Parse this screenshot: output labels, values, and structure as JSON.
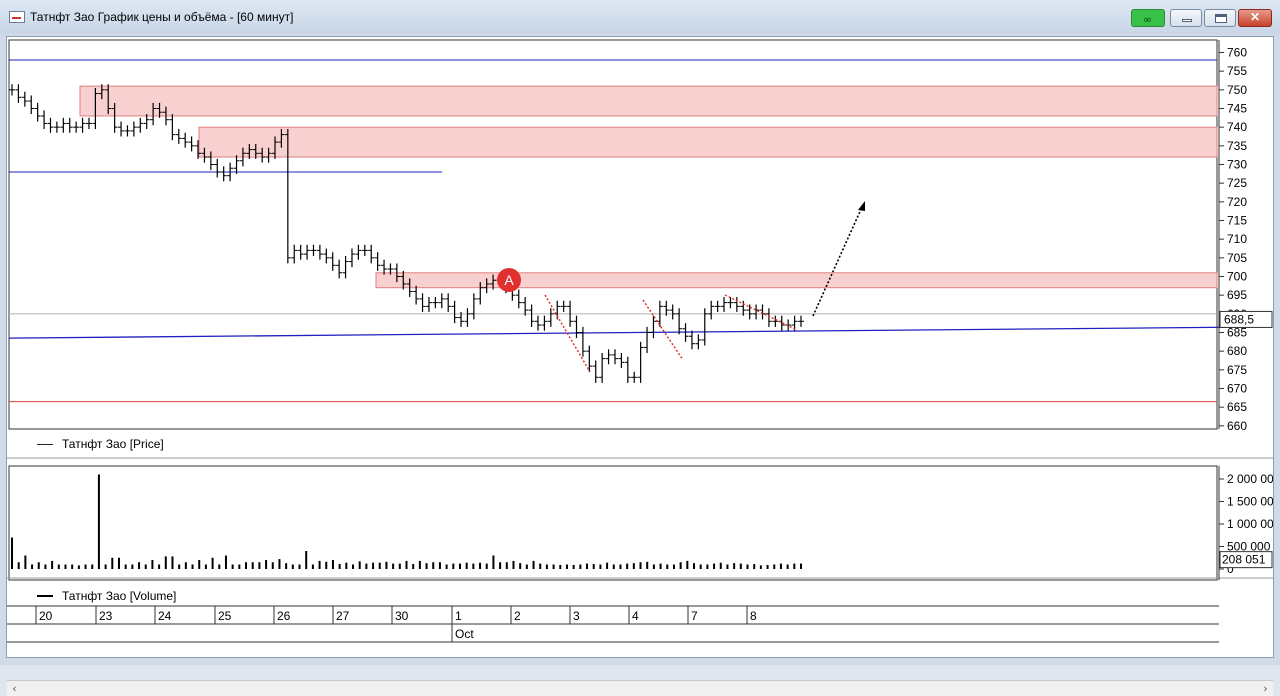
{
  "window": {
    "title": "Татнфт Зао График цены и объёма - [60 минут]",
    "close_label": "✕"
  },
  "price_panel": {
    "legend": "Татнфт Зао [Price]",
    "last_value_label": "688,5"
  },
  "volume_panel": {
    "legend": "Татнфт Зао [Volume]",
    "last_value_label": "208 051"
  },
  "annotation_marker": "A",
  "colors": {
    "zone_fill": "#f8d0d0",
    "zone_stroke": "#e08080",
    "support_line": "#2020c0",
    "bottom_line": "#e04040",
    "bars": "#000000",
    "projection_arrow": "#000000",
    "marker_bg": "#e03030",
    "dotted_trend": "#e03030"
  },
  "chart_data": [
    {
      "type": "ohlc",
      "title": "",
      "y_axis": {
        "min": 658,
        "max": 763,
        "ticks": [
          760,
          755,
          750,
          745,
          740,
          735,
          730,
          725,
          720,
          715,
          710,
          705,
          700,
          695,
          690,
          685,
          680,
          675,
          670,
          665,
          660
        ]
      },
      "x_axis": {
        "ticks": [
          "20",
          "23",
          "24",
          "25",
          "26",
          "27",
          "30",
          "1",
          "2",
          "3",
          "4",
          "7",
          "8"
        ],
        "month_label": "Oct"
      },
      "price_series": [
        750,
        748,
        747,
        745,
        743,
        741,
        740,
        740,
        741,
        740,
        740,
        741,
        741,
        749,
        750,
        745,
        740,
        739,
        739,
        740,
        741,
        742,
        745,
        744,
        742,
        738,
        737,
        736,
        735,
        733,
        732,
        730,
        728,
        727,
        729,
        731,
        733,
        734,
        733,
        732,
        733,
        736,
        738,
        705,
        707,
        706,
        707,
        707,
        706,
        705,
        703,
        701,
        704,
        706,
        707,
        707,
        705,
        703,
        702,
        702,
        700,
        698,
        696,
        694,
        692,
        693,
        693,
        694,
        692,
        689,
        688,
        690,
        694,
        697,
        698,
        699,
        699,
        697,
        695,
        693,
        691,
        688,
        687,
        688,
        690,
        692,
        692,
        688,
        685,
        680,
        676,
        673,
        678,
        679,
        678,
        677,
        673,
        673,
        681,
        685,
        688,
        692,
        691,
        690,
        686,
        684,
        682,
        683,
        690,
        692,
        692,
        693,
        693,
        692,
        691,
        690,
        691,
        690,
        688,
        688,
        687,
        687,
        688,
        688
      ],
      "zones": [
        {
          "low": 743,
          "high": 751,
          "from": "23"
        },
        {
          "low": 732,
          "high": 740,
          "from": "25"
        },
        {
          "low": 697,
          "high": 701,
          "from": "30"
        }
      ],
      "horizontal_lines": [
        {
          "value": 758,
          "color": "support_line"
        },
        {
          "value": 728,
          "color": "support_line",
          "until": "1"
        },
        {
          "value": 666.5,
          "color": "bottom_line"
        },
        {
          "value": 690,
          "color": "gray"
        }
      ],
      "trend_line": {
        "from": 683.5,
        "to": 686.5,
        "color": "support_line"
      },
      "last_value": 688.5
    },
    {
      "type": "bar",
      "title": "",
      "y_axis": {
        "min": 0,
        "max": 2000000,
        "tick_labels": [
          "2 000 00",
          "1 500 00",
          "1 000 00",
          "500 000",
          "0"
        ],
        "tick_values": [
          2000000,
          1500000,
          1000000,
          500000,
          0
        ]
      },
      "values": [
        700000,
        150000,
        300000,
        100000,
        150000,
        100000,
        180000,
        100000,
        100000,
        100000,
        80000,
        100000,
        100000,
        2100000,
        100000,
        250000,
        250000,
        100000,
        100000,
        150000,
        100000,
        200000,
        100000,
        280000,
        280000,
        100000,
        150000,
        100000,
        200000,
        100000,
        250000,
        100000,
        300000,
        100000,
        100000,
        150000,
        150000,
        150000,
        200000,
        150000,
        220000,
        130000,
        100000,
        100000,
        400000,
        100000,
        180000,
        160000,
        200000,
        110000,
        140000,
        100000,
        170000,
        120000,
        140000,
        140000,
        160000,
        120000,
        120000,
        180000,
        110000,
        180000,
        130000,
        150000,
        150000,
        100000,
        120000,
        120000,
        140000,
        120000,
        140000,
        120000,
        300000,
        150000,
        150000,
        180000,
        130000,
        100000,
        180000,
        120000,
        100000,
        100000,
        90000,
        100000,
        90000,
        100000,
        120000,
        110000,
        100000,
        140000,
        100000,
        100000,
        120000,
        130000,
        150000,
        160000,
        100000,
        120000,
        100000,
        100000,
        150000,
        180000,
        130000,
        100000,
        100000,
        120000,
        140000,
        100000,
        130000,
        120000,
        100000,
        110000,
        80000,
        90000,
        100000,
        120000,
        100000,
        120000,
        120000
      ],
      "last_value": 208051
    }
  ]
}
